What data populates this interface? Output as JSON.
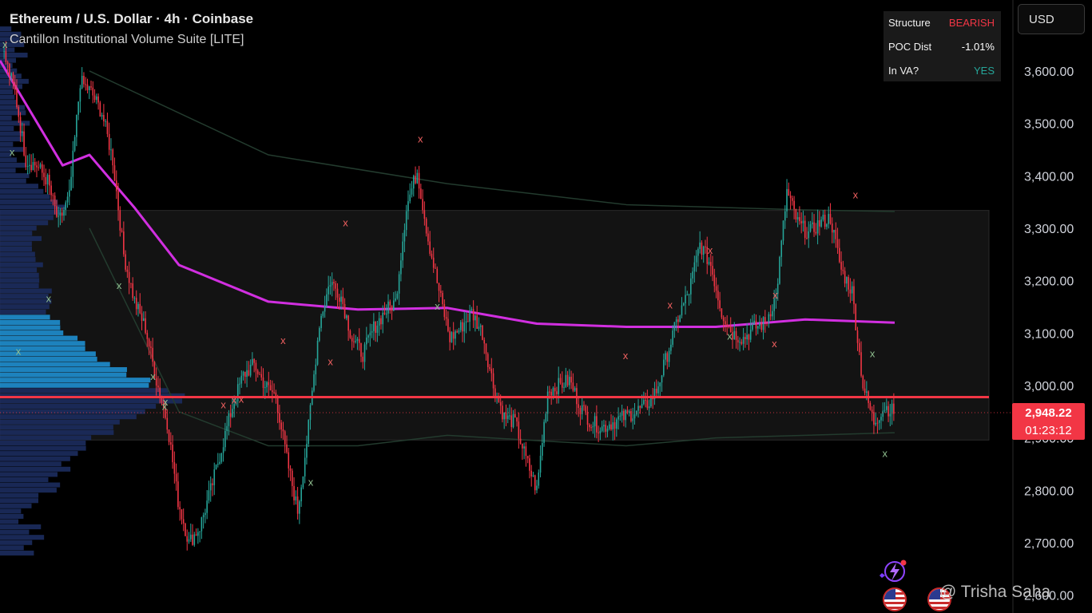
{
  "header": {
    "title": "Ethereum / U.S. Dollar · 4h · Coinbase",
    "indicator_name": "Cantillon Institutional Volume Suite [LITE]"
  },
  "info_table": {
    "rows": [
      {
        "label": "Structure",
        "value": "BEARISH",
        "color": "#f23645"
      },
      {
        "label": "POC Dist",
        "value": "-1.01%",
        "color": "#ffffff"
      },
      {
        "label": "In VA?",
        "value": "YES",
        "color": "#26a69a"
      }
    ]
  },
  "currency": "USD",
  "last_price": {
    "price": "2,948.22",
    "countdown": "01:23:12",
    "color": "#f23645"
  },
  "watermark": "@ Trisha Saha",
  "colors": {
    "up": "#26a69a",
    "down": "#f23645",
    "vwap": "#d12fe0",
    "poc": "#f23645",
    "profile_dark": "#1c2c5e",
    "profile_light": "#1f8fd0",
    "value_area": "#131313"
  },
  "icons": [
    "lightning-icon",
    "us-flag-icon"
  ],
  "chart_data": {
    "type": "candlestick",
    "title": "Ethereum / U.S. Dollar · 4h · Coinbase",
    "y_axis": {
      "ticks": [
        3600,
        3500,
        3400,
        3300,
        3200,
        3100,
        3000,
        2900,
        2800,
        2700,
        2600
      ],
      "tick_labels": [
        "3,600.00",
        "3,500.00",
        "3,400.00",
        "3,300.00",
        "3,200.00",
        "3,100.00",
        "3,000.00",
        "2,900.00",
        "2,800.00",
        "2,700.00",
        "2,600.00"
      ],
      "ylim": [
        2580,
        3700
      ]
    },
    "price_path": [
      3630,
      3560,
      3430,
      3420,
      3390,
      3310,
      3360,
      3580,
      3560,
      3520,
      3430,
      3250,
      3160,
      3110,
      3010,
      2930,
      2780,
      2700,
      2730,
      2800,
      2880,
      2960,
      3020,
      3040,
      3000,
      2980,
      2860,
      2760,
      2920,
      3120,
      3200,
      3170,
      3090,
      3060,
      3110,
      3140,
      3160,
      3340,
      3410,
      3280,
      3180,
      3090,
      3110,
      3140,
      3100,
      3000,
      2940,
      2930,
      2860,
      2800,
      2990,
      3000,
      3010,
      2960,
      2930,
      2920,
      2930,
      2940,
      2950,
      2960,
      2990,
      3060,
      3130,
      3180,
      3270,
      3230,
      3140,
      3100,
      3090,
      3110,
      3120,
      3170,
      3370,
      3310,
      3290,
      3310,
      3320,
      3220,
      3180,
      3000,
      2930,
      2960,
      2948.22
    ],
    "series": [
      {
        "name": "VWAP",
        "color": "#d12fe0",
        "x": [
          0,
          0.07,
          0.1,
          0.15,
          0.2,
          0.3,
          0.4,
          0.5,
          0.6,
          0.7,
          0.8,
          0.9,
          1.0
        ],
        "values": [
          3620,
          3420,
          3440,
          3340,
          3230,
          3160,
          3145,
          3148,
          3118,
          3112,
          3112,
          3126,
          3120
        ]
      },
      {
        "name": "VWAP Upper",
        "color": "#233b2e",
        "x": [
          0.1,
          0.3,
          0.5,
          0.7,
          0.9,
          1.0
        ],
        "values": [
          3600,
          3440,
          3385,
          3345,
          3335,
          3332
        ]
      },
      {
        "name": "VWAP Lower",
        "color": "#233b2e",
        "x": [
          0.1,
          0.2,
          0.3,
          0.4,
          0.5,
          0.6,
          0.7,
          0.8,
          0.9,
          1.0
        ],
        "values": [
          3300,
          2950,
          2885,
          2885,
          2905,
          2895,
          2885,
          2900,
          2905,
          2910
        ]
      }
    ],
    "poc_price": 2978,
    "value_area": {
      "high": 3334,
      "low": 2896
    },
    "swing_highs": [
      3470,
      3310,
      3085,
      3045,
      2973,
      2972,
      2963,
      3056,
      3257,
      3153,
      3172,
      3079,
      3363
    ],
    "swing_lows": [
      3650,
      3445,
      3190,
      3165,
      3065,
      3017,
      2968,
      2960,
      2815,
      3151,
      3094,
      3060,
      2870
    ]
  }
}
